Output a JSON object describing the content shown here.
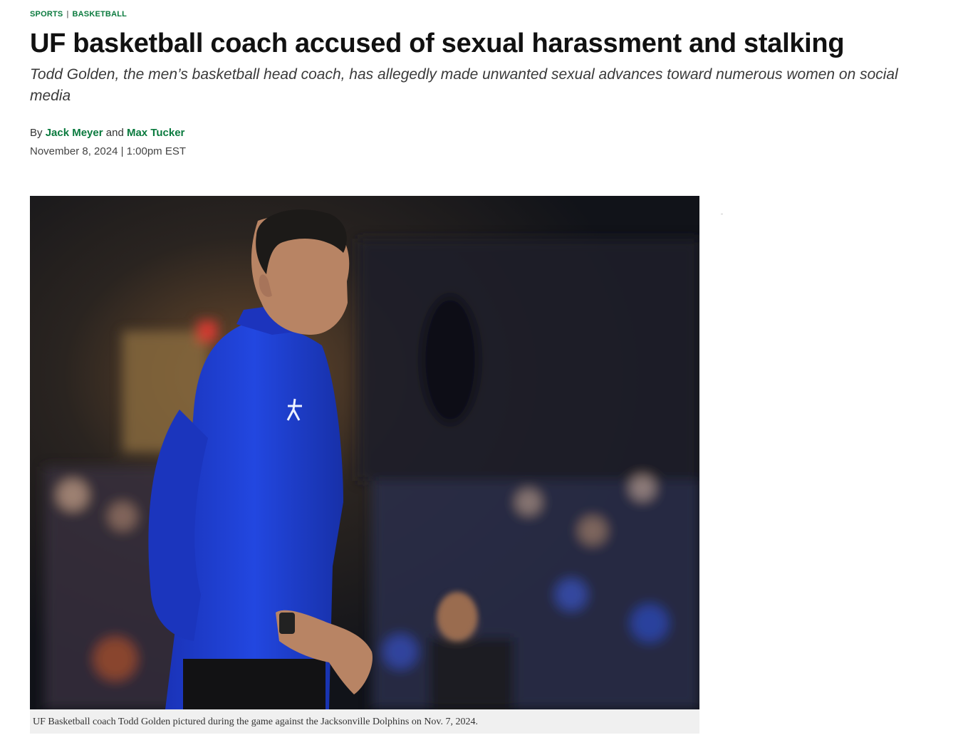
{
  "breadcrumb": {
    "section": "SPORTS",
    "separator": "|",
    "subsection": "BASKETBALL"
  },
  "article": {
    "headline": "UF basketball coach accused of sexual harassment and stalking",
    "dek": "Todd Golden, the men’s basketball head coach, has allegedly made unwanted sexual advances toward numerous women on social media",
    "byline": {
      "prefix": "By",
      "author1": "Jack Meyer",
      "conjunction": "and",
      "author2": "Max Tucker"
    },
    "date": "November 8, 2024 | 1:00pm EST"
  },
  "figure": {
    "caption": "UF Basketball coach Todd Golden pictured during the game against the Jacksonville Dolphins on Nov. 7, 2024."
  },
  "colors": {
    "accent": "#0a7a3e",
    "jersey": "#1f3fd6",
    "caption_bg": "#f0f0f0"
  }
}
